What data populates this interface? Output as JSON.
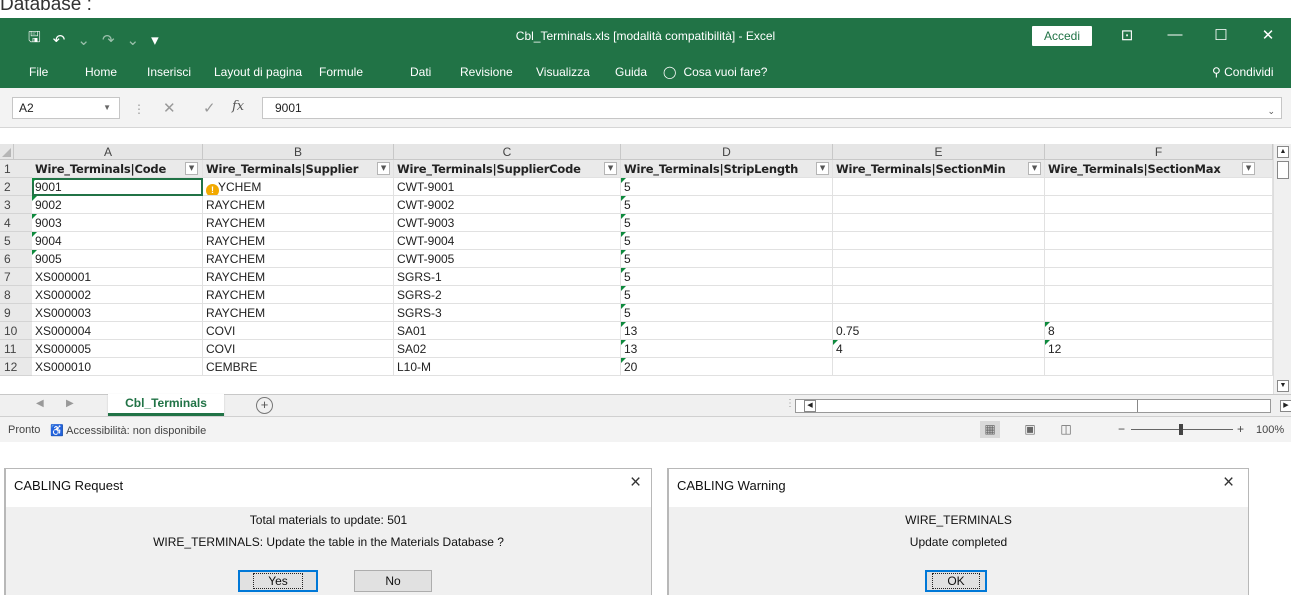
{
  "page": {
    "caption": "Database :"
  },
  "excel": {
    "title": "Cbl_Terminals.xls [modalità compatibilità] - Excel",
    "signin_label": "Accedi",
    "quick_access": {
      "save": "🖫",
      "undo": "↶",
      "undo_dd": "⌄",
      "redo": "↷",
      "redo_dd": "⌄",
      "customize": "▾"
    },
    "window_buttons": {
      "ribbon_display": "⊡",
      "minimize": "—",
      "maximize": "☐",
      "close": "✕"
    },
    "ribbon_tabs": [
      "File",
      "Home",
      "Inserisci",
      "Layout di pagina",
      "Formule",
      "Dati",
      "Revisione",
      "Visualizza",
      "Guida"
    ],
    "tell_me": "Cosa vuoi fare?",
    "share_label": "Condividi",
    "name_box": "A2",
    "formula_value": "9001",
    "columns": [
      "A",
      "B",
      "C",
      "D",
      "E",
      "F"
    ],
    "header_row": [
      "Wire_Terminals|Code",
      "Wire_Terminals|Supplier",
      "Wire_Terminals|SupplierCode",
      "Wire_Terminals|StripLength",
      "Wire_Terminals|SectionMin",
      "Wire_Terminals|SectionMax"
    ],
    "rows": [
      {
        "n": "2",
        "a": "9001",
        "b": "YCHEM",
        "c": "CWT-9001",
        "d": "5",
        "e": "",
        "f": ""
      },
      {
        "n": "3",
        "a": "9002",
        "b": "RAYCHEM",
        "c": "CWT-9002",
        "d": "5",
        "e": "",
        "f": ""
      },
      {
        "n": "4",
        "a": "9003",
        "b": "RAYCHEM",
        "c": "CWT-9003",
        "d": "5",
        "e": "",
        "f": ""
      },
      {
        "n": "5",
        "a": "9004",
        "b": "RAYCHEM",
        "c": "CWT-9004",
        "d": "5",
        "e": "",
        "f": ""
      },
      {
        "n": "6",
        "a": "9005",
        "b": "RAYCHEM",
        "c": "CWT-9005",
        "d": "5",
        "e": "",
        "f": ""
      },
      {
        "n": "7",
        "a": "XS000001",
        "b": "RAYCHEM",
        "c": "SGRS-1",
        "d": "5",
        "e": "",
        "f": ""
      },
      {
        "n": "8",
        "a": "XS000002",
        "b": "RAYCHEM",
        "c": "SGRS-2",
        "d": "5",
        "e": "",
        "f": ""
      },
      {
        "n": "9",
        "a": "XS000003",
        "b": "RAYCHEM",
        "c": "SGRS-3",
        "d": "5",
        "e": "",
        "f": ""
      },
      {
        "n": "10",
        "a": "XS000004",
        "b": "COVI",
        "c": "SA01",
        "d": "13",
        "e": "0.75",
        "f": "8"
      },
      {
        "n": "11",
        "a": "XS000005",
        "b": "COVI",
        "c": "SA02",
        "d": "13",
        "e": "4",
        "f": "12"
      },
      {
        "n": "12",
        "a": "XS000010",
        "b": "CEMBRE",
        "c": "L10-M",
        "d": "20",
        "e": "",
        "f": ""
      }
    ],
    "header_row_number": "1",
    "sheet_tab": "Cbl_Terminals",
    "status_text": "Pronto",
    "accessibility_text": "Accessibilità: non disponibile",
    "zoom_level": "100%",
    "accent_color": "#217346"
  },
  "dialog_request": {
    "title": "CABLING Request",
    "line1": "Total materials to update: 501",
    "line2": "WIRE_TERMINALS: Update the table in the Materials Database ?",
    "yes_label": "Yes",
    "no_label": "No"
  },
  "dialog_warning": {
    "title": "CABLING Warning",
    "line1": "WIRE_TERMINALS",
    "line2": "Update completed",
    "ok_label": "OK"
  }
}
